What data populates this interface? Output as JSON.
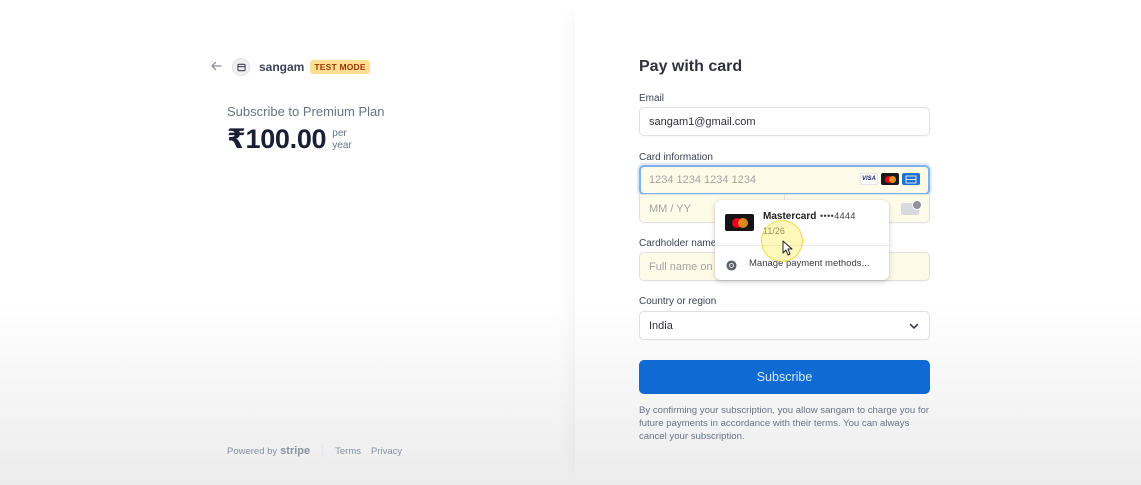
{
  "merchant": {
    "name": "sangam",
    "mode_badge": "TEST MODE"
  },
  "product": {
    "title": "Subscribe to Premium Plan",
    "price": "₹100.00",
    "period_line1": "per",
    "period_line2": "year"
  },
  "footer": {
    "powered_by": "Powered by",
    "brand": "stripe",
    "terms": "Terms",
    "privacy": "Privacy"
  },
  "form": {
    "title": "Pay with card",
    "email": {
      "label": "Email",
      "value": "sangam1@gmail.com"
    },
    "card": {
      "label": "Card information",
      "number_placeholder": "1234 1234 1234 1234",
      "expiry_placeholder": "MM / YY",
      "brands": [
        "visa",
        "mastercard",
        "amex"
      ],
      "brand_visa_text": "VISA"
    },
    "cardholder": {
      "label": "Cardholder name",
      "placeholder": "Full name on card"
    },
    "country": {
      "label": "Country or region",
      "value": "India"
    },
    "subscribe_label": "Subscribe",
    "consent": "By confirming your subscription, you allow sangam to charge you for future payments in accordance with their terms. You can always cancel your subscription."
  },
  "autofill_popup": {
    "card_brand": "Mastercard",
    "card_number_masked": "••••4444",
    "expiry": "11/26",
    "manage_label": "Manage payment methods..."
  },
  "colors": {
    "primary_button": "#0f6bd3",
    "badge_bg": "#ffde92",
    "badge_text": "#983705",
    "autofill_bg": "#fefbe8"
  }
}
